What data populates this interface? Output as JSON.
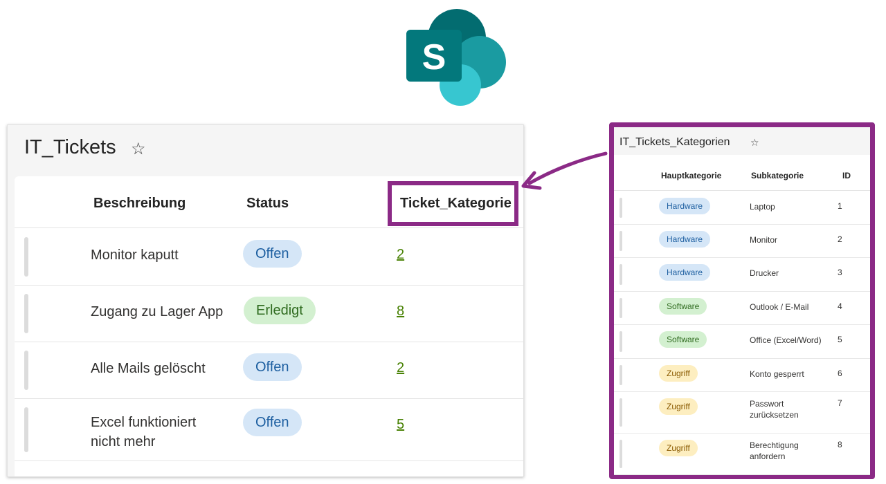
{
  "logo": {
    "letter": "S"
  },
  "left": {
    "title": "IT_Tickets",
    "star": "☆",
    "columns": [
      "Beschreibung",
      "Status",
      "Ticket_Kategorie"
    ],
    "rows": [
      {
        "desc": "Monitor kaputt",
        "status": "Offen",
        "kat": "2"
      },
      {
        "desc": "Zugang zu Lager App",
        "status": "Erledigt",
        "kat": "8"
      },
      {
        "desc": "Alle Mails gelöscht",
        "status": "Offen",
        "kat": "2"
      },
      {
        "desc": "Excel funktioniert nicht mehr",
        "status": "Offen",
        "kat": "5"
      }
    ]
  },
  "right": {
    "title": "IT_Tickets_Kategorien",
    "star": "☆",
    "columns": [
      "Hauptkategorie",
      "Subkategorie",
      "ID"
    ],
    "rows": [
      {
        "haupt": "Hardware",
        "sub": "Laptop",
        "id": "1"
      },
      {
        "haupt": "Hardware",
        "sub": "Monitor",
        "id": "2"
      },
      {
        "haupt": "Hardware",
        "sub": "Drucker",
        "id": "3"
      },
      {
        "haupt": "Software",
        "sub": "Outlook / E-Mail",
        "id": "4"
      },
      {
        "haupt": "Software",
        "sub": "Office (Excel/Word)",
        "id": "5"
      },
      {
        "haupt": "Zugriff",
        "sub": "Konto gesperrt",
        "id": "6"
      },
      {
        "haupt": "Zugriff",
        "sub": "Passwort zurücksetzen",
        "id": "7"
      },
      {
        "haupt": "Zugriff",
        "sub": "Berechtigung anfordern",
        "id": "8"
      }
    ]
  },
  "colors": {
    "highlight": "#8b2a86",
    "offen_bg": "#d5e6f7",
    "offen_fg": "#1c5ea0",
    "erledigt_bg": "#d3f0d0",
    "erledigt_fg": "#2f6b1f",
    "zugriff_bg": "#fdeec0",
    "zugriff_fg": "#8a5a00",
    "link": "#498205"
  }
}
